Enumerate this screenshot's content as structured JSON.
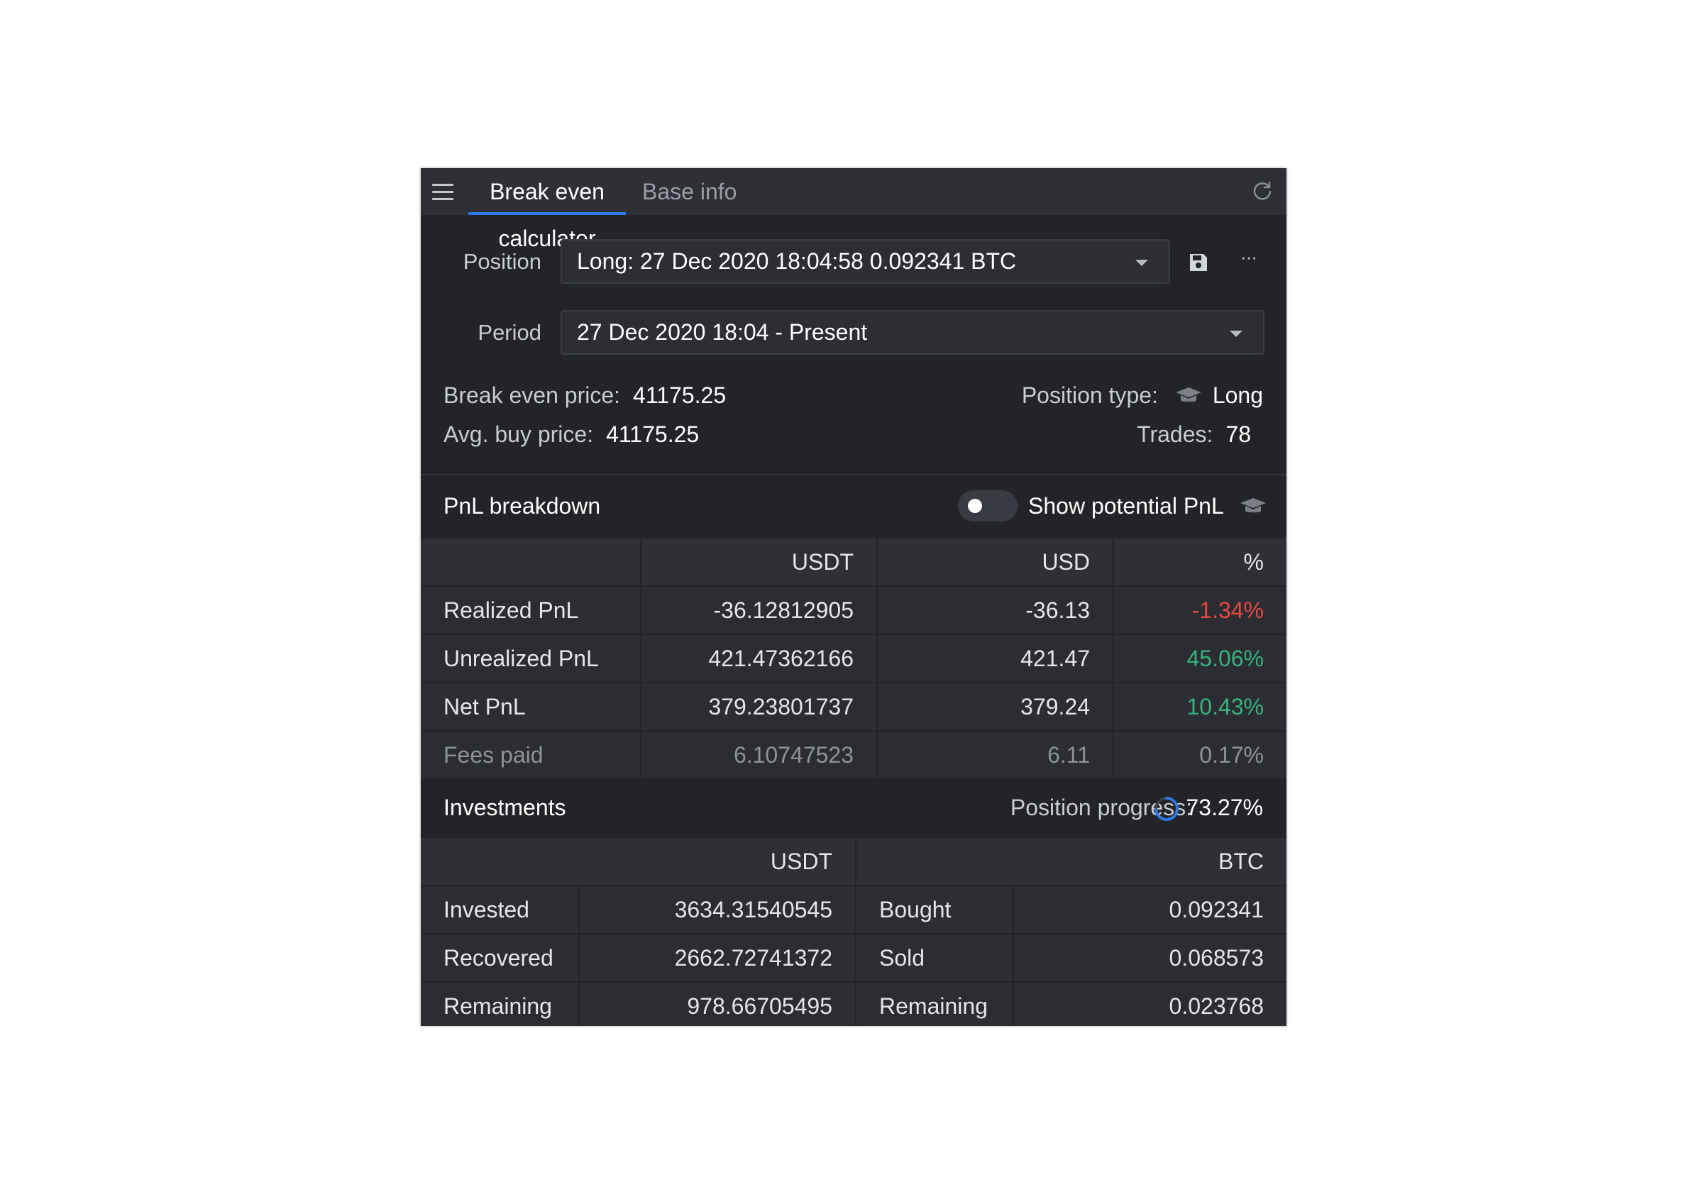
{
  "colors": {
    "accent": "#2c7be5",
    "negative": "#e84a3f",
    "positive": "#36b37e",
    "panel_bg": "#222428",
    "header_bg": "#2e3035"
  },
  "icons": {
    "menu": "menu-icon",
    "refresh": "refresh-icon",
    "save": "save-icon",
    "more": "more-icon",
    "caret": "chevron-down-icon",
    "education": "graduation-cap-icon",
    "progress": "progress-ring-icon"
  },
  "header": {
    "tabs": [
      {
        "label": "Break even calculator",
        "active": true
      },
      {
        "label": "Base info",
        "active": false
      }
    ]
  },
  "form": {
    "position_label": "Position",
    "position_value": "Long: 27 Dec 2020 18:04:58 0.092341 BTC",
    "period_label": "Period",
    "period_value": "27 Dec 2020 18:04 - Present",
    "more_label": "···"
  },
  "summary": {
    "break_even_label": "Break even price:",
    "break_even_value": "41175.25",
    "avg_buy_label": "Avg. buy price:",
    "avg_buy_value": "41175.25",
    "position_type_label": "Position type:",
    "position_type_value": "Long",
    "trades_label": "Trades:",
    "trades_value": "78"
  },
  "pnl": {
    "title": "PnL breakdown",
    "toggle_label": "Show potential PnL",
    "toggle_on": false,
    "columns": [
      "",
      "USDT",
      "USD",
      "%"
    ],
    "rows": [
      {
        "label": "Realized PnL",
        "usdt": "-36.12812905",
        "usd": "-36.13",
        "pct": "-1.34%",
        "tone": "negative"
      },
      {
        "label": "Unrealized PnL",
        "usdt": "421.47362166",
        "usd": "421.47",
        "pct": "45.06%",
        "tone": "positive"
      },
      {
        "label": "Net PnL",
        "usdt": "379.23801737",
        "usd": "379.24",
        "pct": "10.43%",
        "tone": "positive"
      },
      {
        "label": "Fees paid",
        "usdt": "6.10747523",
        "usd": "6.11",
        "pct": "0.17%",
        "tone": "muted"
      }
    ]
  },
  "investments": {
    "title": "Investments",
    "progress_label": "Position progress:",
    "progress_value": "73.27%",
    "progress_fraction": 0.7327,
    "columns": [
      "USDT",
      "BTC"
    ],
    "rows": [
      {
        "left_label": "Invested",
        "left_value": "3634.31540545",
        "right_label": "Bought",
        "right_value": "0.092341"
      },
      {
        "left_label": "Recovered",
        "left_value": "2662.72741372",
        "right_label": "Sold",
        "right_value": "0.068573"
      },
      {
        "left_label": "Remaining",
        "left_value": "978.66705495",
        "right_label": "Remaining",
        "right_value": "0.023768"
      }
    ]
  }
}
